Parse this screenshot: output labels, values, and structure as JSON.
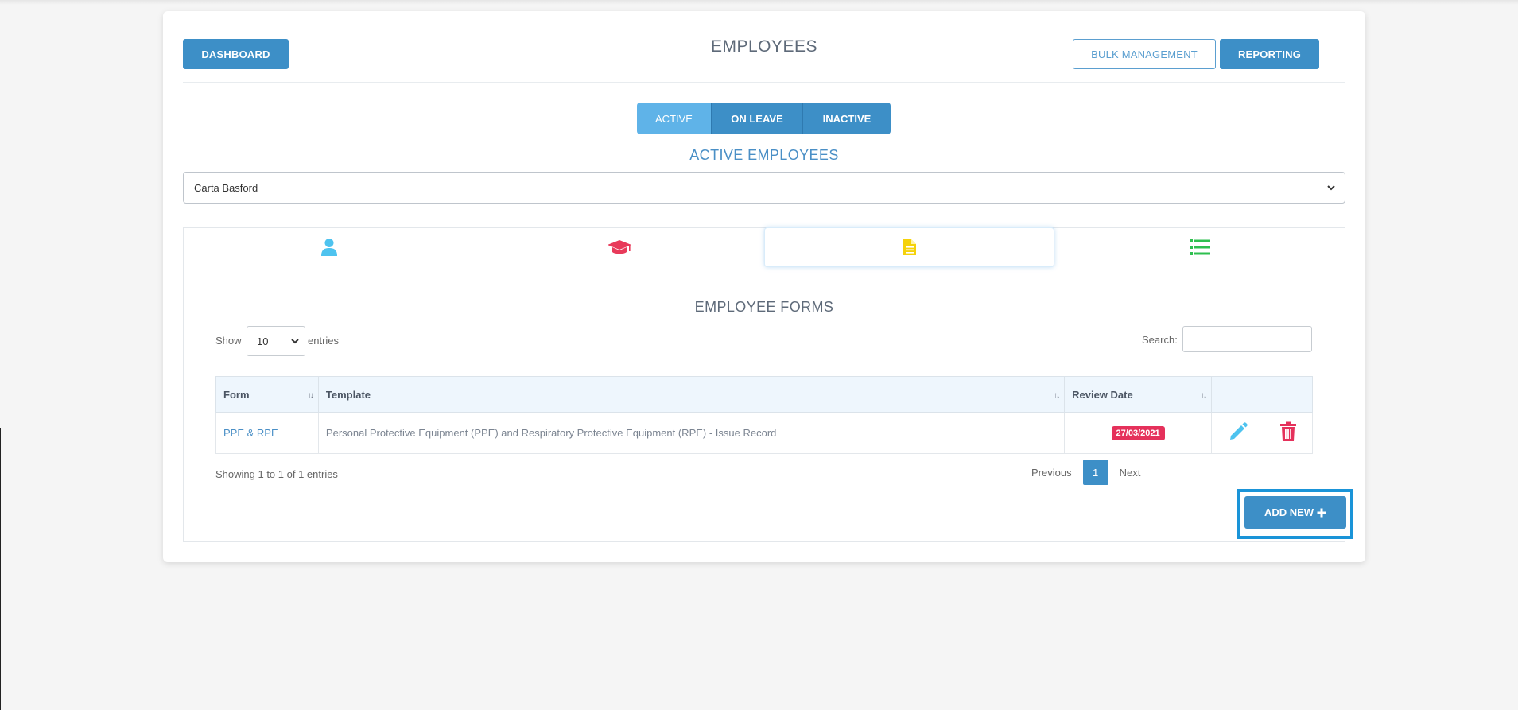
{
  "header": {
    "dashboard_label": "DASHBOARD",
    "title": "EMPLOYEES",
    "bulk_label": "BULK MANAGEMENT",
    "reporting_label": "REPORTING"
  },
  "status_tabs": {
    "active": "ACTIVE",
    "on_leave": "ON LEAVE",
    "inactive": "INACTIVE"
  },
  "subtitle": "ACTIVE EMPLOYEES",
  "employee_select": {
    "selected": "Carta Basford"
  },
  "section_tabs": [
    {
      "icon": "user-icon",
      "color": "#4ec3ef"
    },
    {
      "icon": "graduation-cap-icon",
      "color": "#e83a5a"
    },
    {
      "icon": "document-icon",
      "color": "#f5d20a"
    },
    {
      "icon": "list-icon",
      "color": "#2ebf4f"
    }
  ],
  "forms": {
    "title": "EMPLOYEE FORMS",
    "show_label": "Show",
    "entries_label": "entries",
    "page_length": "10",
    "search_label": "Search:",
    "columns": [
      "Form",
      "Template",
      "Review Date"
    ],
    "rows": [
      {
        "form": "PPE & RPE",
        "template": "Personal Protective Equipment (PPE) and Respiratory Protective Equipment (RPE) - Issue Record",
        "review_date": "27/03/2021"
      }
    ],
    "info": "Showing 1 to 1 of 1 entries",
    "pager": {
      "previous": "Previous",
      "page": "1",
      "next": "Next"
    },
    "add_new_label": "ADD NEW"
  },
  "colors": {
    "primary": "#3d8fc7",
    "active_tab": "#5fb3e8",
    "danger": "#e5315b",
    "edit_icon": "#4ec3ef",
    "highlight": "#1a94d8"
  }
}
